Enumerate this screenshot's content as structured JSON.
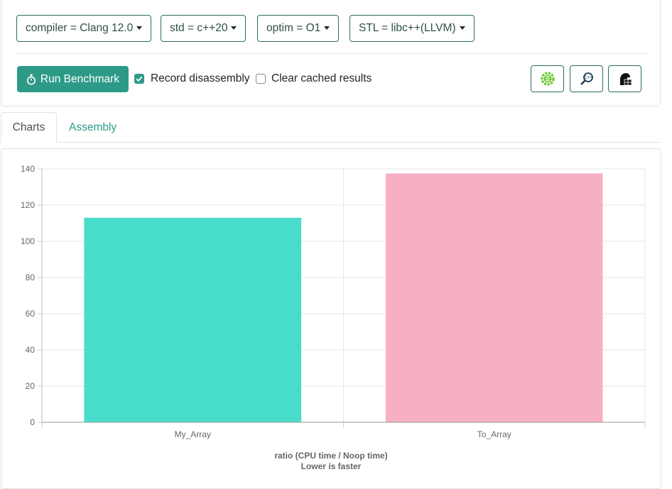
{
  "settings": {
    "dropdowns": [
      {
        "label": "compiler = Clang 12.0"
      },
      {
        "label": "std = c++20"
      },
      {
        "label": "optim = O1"
      },
      {
        "label": "STL = libc++(LLVM)"
      }
    ],
    "run_button_label": "Run Benchmark",
    "record_disassembly": {
      "label": "Record disassembly",
      "checked": true
    },
    "clear_cache": {
      "label": "Clear cached results",
      "checked": false
    },
    "accent_color": "#2d9a87",
    "border_color": "#2a6e63"
  },
  "tabs": [
    {
      "label": "Charts",
      "active": true
    },
    {
      "label": "Assembly",
      "active": false
    }
  ],
  "chart_data": {
    "type": "bar",
    "categories": [
      "My_Array",
      "To_Array"
    ],
    "values": [
      113,
      137.5
    ],
    "colors": [
      "#48dccb",
      "#f7b0c1"
    ],
    "xlabel": "ratio (CPU time / Noop time)",
    "xlabel2": "Lower is faster",
    "ylim": [
      0,
      140
    ],
    "yticks": [
      0,
      20,
      40,
      60,
      80,
      100,
      120,
      140
    ],
    "grid": true
  }
}
